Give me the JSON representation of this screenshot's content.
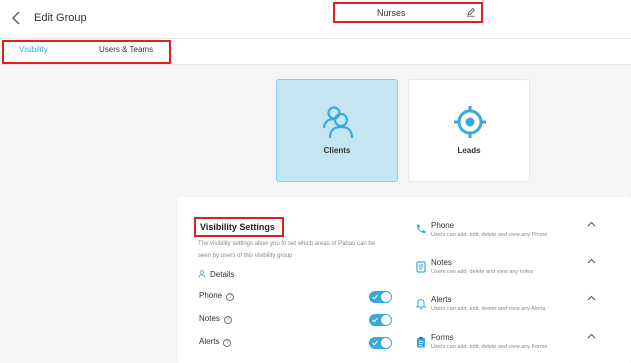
{
  "header": {
    "title": "Edit Group",
    "group_name": "Nurses"
  },
  "tabs": [
    {
      "label": "Visibility",
      "active": true
    },
    {
      "label": "Users & Teams",
      "active": false
    }
  ],
  "cards": [
    {
      "label": "Clients",
      "icon": "users-icon",
      "selected": true
    },
    {
      "label": "Leads",
      "icon": "target-icon",
      "selected": false
    }
  ],
  "visibility": {
    "title": "Visibility Settings",
    "description": "The visibility settings allow you to set which areas of Pabau can be seen by users of this visibility group",
    "details_label": "Details",
    "toggles": [
      {
        "label": "Phone",
        "on": true
      },
      {
        "label": "Notes",
        "on": true
      },
      {
        "label": "Alerts",
        "on": true
      }
    ]
  },
  "modules": [
    {
      "title": "Phone",
      "desc": "Users can add, edit, delete and view any Phone",
      "icon": "phone-icon"
    },
    {
      "title": "Notes",
      "desc": "Users can add, delete and view any notes",
      "icon": "notes-icon"
    },
    {
      "title": "Alerts",
      "desc": "Users can add, edit, delete and view any Alerts",
      "icon": "bell-icon"
    },
    {
      "title": "Forms",
      "desc": "Users can add, edit, delete and view any Forms",
      "icon": "clipboard-icon"
    }
  ],
  "colors": {
    "accent": "#39a9dc",
    "highlight_border": "#e0201c",
    "selected_card_bg": "#c6e5f3"
  }
}
